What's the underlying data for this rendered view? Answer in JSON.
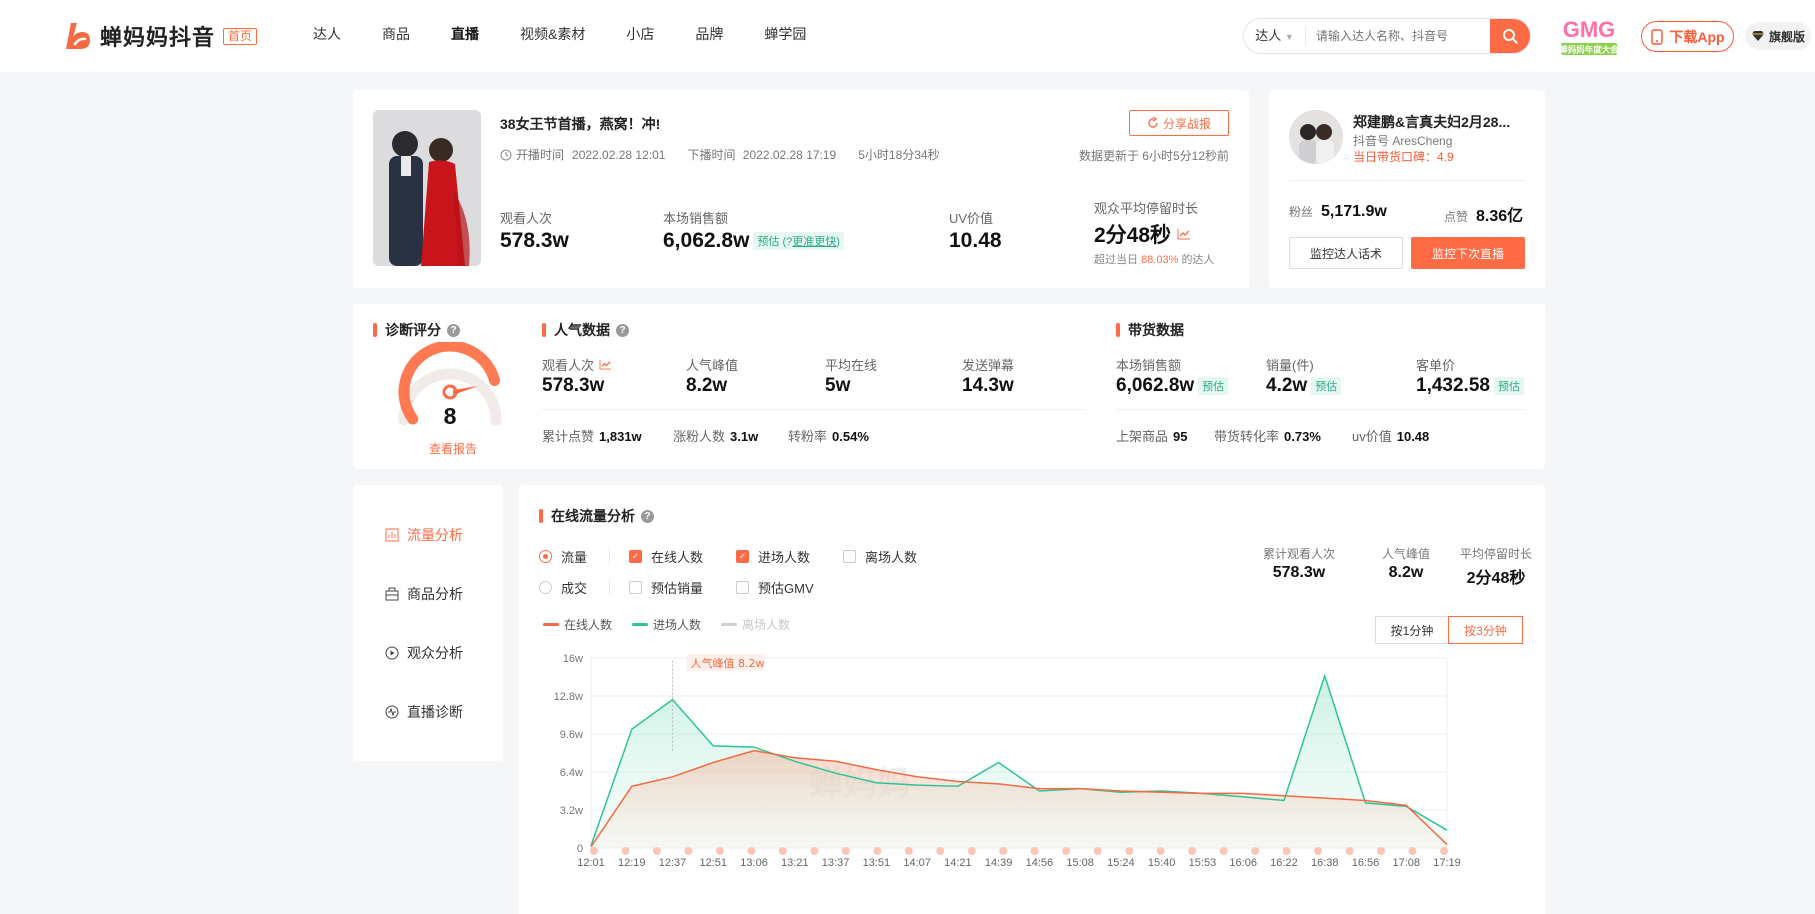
{
  "header": {
    "logo_text": "蝉妈妈抖音",
    "home_tag": "首页",
    "nav": [
      "达人",
      "商品",
      "直播",
      "视频&素材",
      "小店",
      "品牌",
      "蝉学园"
    ],
    "nav_active": "直播",
    "search_type": "达人",
    "search_placeholder": "请输入达人名称、抖音号",
    "gmg_brand": "GMG",
    "gmg_caption": "蝉妈妈年度大会",
    "download_label": "下载App",
    "flagship_label": "旗舰版"
  },
  "live": {
    "title": "38女王节首播，燕窝！冲!",
    "start_label": "开播时间",
    "start_time": "2022.02.28 12:01",
    "end_label": "下播时间",
    "end_time": "2022.02.28 17:19",
    "duration": "5小时18分34秒",
    "share_label": "分享战报",
    "update_note": "数据更新于 6小时5分12秒前",
    "stats": {
      "viewers_label": "观看人次",
      "viewers": "578.3w",
      "sales_label": "本场销售额",
      "sales": "6,062.8w",
      "sales_tag": "预估",
      "sales_tag_link": "更准更快",
      "uv_label": "UV价值",
      "uv": "10.48",
      "stay_label": "观众平均停留时长",
      "stay": "2分48秒",
      "stay_note_pre": "超过当日",
      "stay_pct": "88.03%",
      "stay_note_post": "的达人"
    }
  },
  "influencer": {
    "name": "郑建鹏&言真夫妇2月28...",
    "id_text": "抖音号 AresCheng",
    "score_text": "当日带货口碑：4.9",
    "fans_label": "粉丝",
    "fans": "5,171.9w",
    "likes_label": "点赞",
    "likes": "8.36亿",
    "btn_monitor_speech": "监控达人话术",
    "btn_monitor_next": "监控下次直播"
  },
  "diagnosis": {
    "title": "诊断评分",
    "score": "8",
    "score_value": 8,
    "score_max": 10,
    "link": "查看报告"
  },
  "popularity": {
    "title": "人气数据",
    "main": [
      {
        "label": "观看人次",
        "value": "578.3w"
      },
      {
        "label": "人气峰值",
        "value": "8.2w"
      },
      {
        "label": "平均在线",
        "value": "5w"
      },
      {
        "label": "发送弹幕",
        "value": "14.3w"
      }
    ],
    "mini": [
      {
        "label": "累计点赞",
        "value": "1,831w"
      },
      {
        "label": "涨粉人数",
        "value": "3.1w"
      },
      {
        "label": "转粉率",
        "value": "0.54%"
      }
    ]
  },
  "goods": {
    "title": "带货数据",
    "main": [
      {
        "label": "本场销售额",
        "value": "6,062.8w",
        "tag": "预估"
      },
      {
        "label": "销量(件)",
        "value": "4.2w",
        "tag": "预估"
      },
      {
        "label": "客单价",
        "value": "1,432.58",
        "tag": "预估"
      }
    ],
    "mini": [
      {
        "label": "上架商品",
        "value": "95"
      },
      {
        "label": "带货转化率",
        "value": "0.73%"
      },
      {
        "label": "uv价值",
        "value": "10.48"
      }
    ]
  },
  "sidebar": {
    "items": [
      "流量分析",
      "商品分析",
      "观众分析",
      "直播诊断"
    ],
    "active": "流量分析"
  },
  "flow": {
    "title": "在线流量分析",
    "radio_flow": "流量",
    "radio_deal": "成交",
    "chk_online": "在线人数",
    "chk_enter": "进场人数",
    "chk_leave": "离场人数",
    "chk_est_sales": "预估销量",
    "chk_est_gmv": "预估GMV",
    "summary": [
      {
        "label": "累计观看人次",
        "value": "578.3w"
      },
      {
        "label": "人气峰值",
        "value": "8.2w"
      },
      {
        "label": "平均停留时长",
        "value": "2分48秒"
      }
    ],
    "gran_1": "按1分钟",
    "gran_3": "按3分钟",
    "peak_label": "人气峰值 8.2w",
    "watermark": "蝉妈妈"
  },
  "chart_data": {
    "type": "line",
    "title": "",
    "xlabel": "",
    "ylabel": "",
    "ylim": [
      0,
      160000
    ],
    "yticks": [
      "0",
      "3.2w",
      "6.4w",
      "9.6w",
      "12.8w",
      "16w"
    ],
    "ytick_values": [
      0,
      32000,
      64000,
      96000,
      128000,
      160000
    ],
    "x": [
      "12:01",
      "12:19",
      "12:37",
      "12:51",
      "13:06",
      "13:21",
      "13:37",
      "13:51",
      "14:07",
      "14:21",
      "14:39",
      "14:56",
      "15:08",
      "15:24",
      "15:40",
      "15:53",
      "16:06",
      "16:22",
      "16:38",
      "16:56",
      "17:08",
      "17:19"
    ],
    "legend_position": "top-left",
    "grid": true,
    "series": [
      {
        "name": "在线人数",
        "color": "#f26b43",
        "values": [
          1000,
          52000,
          60000,
          72000,
          82000,
          76000,
          73000,
          66000,
          60000,
          56000,
          54000,
          50000,
          50000,
          48000,
          47000,
          46000,
          46000,
          44000,
          42000,
          40000,
          36000,
          3000
        ]
      },
      {
        "name": "进场人数",
        "color": "#2ec496",
        "values": [
          2000,
          100000,
          125000,
          86000,
          85000,
          73000,
          63000,
          55000,
          53000,
          52000,
          72000,
          48000,
          50000,
          47000,
          48000,
          46000,
          43000,
          40000,
          145000,
          38000,
          35000,
          15000
        ]
      },
      {
        "name": "离场人数",
        "color": "#d0d0d0",
        "visible": false,
        "values": []
      }
    ],
    "peak": {
      "x": "12:37",
      "value": 82000
    }
  }
}
